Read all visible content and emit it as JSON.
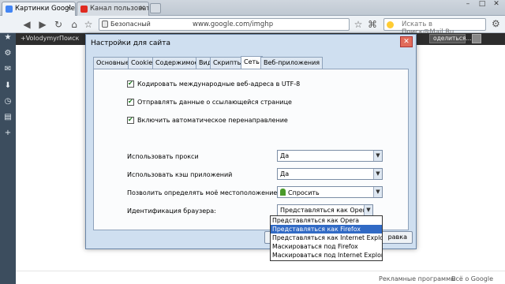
{
  "browser": {
    "tabs": [
      {
        "label": "Картинки Google",
        "active": true
      },
      {
        "label": "Канал пользовате...",
        "active": false
      }
    ],
    "address": {
      "security_label": "Безопасный",
      "url": "www.google.com/imghp"
    },
    "search": {
      "placeholder": "Искать в Поиск@Mail.Ru"
    }
  },
  "google_bar": {
    "user": "+Volodymyr",
    "search": "Поиск",
    "share": "оделиться..."
  },
  "footer": {
    "ads": "Рекламные программы",
    "about": "Всё о Google"
  },
  "dialog": {
    "title": "Настройки для сайта",
    "close_label": "✕",
    "tabs": [
      "Основные",
      "Cookies",
      "Содержимое",
      "Вид",
      "Скрипты",
      "Сеть",
      "Веб-приложения"
    ],
    "selected_tab": "Сеть",
    "checkboxes": [
      {
        "label": "Кодировать международные веб-адреса в UTF-8",
        "checked": true
      },
      {
        "label": "Отправлять данные о ссылающейся странице",
        "checked": true
      },
      {
        "label": "Включить автоматическое перенаправление",
        "checked": true
      }
    ],
    "settings": [
      {
        "label": "Использовать прокси",
        "value": "Да"
      },
      {
        "label": "Использовать кэш приложений",
        "value": "Да"
      },
      {
        "label": "Позволить определять моё местоположение",
        "value": "Спросить"
      },
      {
        "label": "Идентификация браузера:",
        "value": "Представляться как Opera"
      }
    ],
    "help_button": "равка"
  },
  "browser_id_dropdown": {
    "options": [
      "Представляться как Opera",
      "Представляться как Firefox",
      "Представляться как Internet Explorer",
      "Маскироваться под Firefox",
      "Маскироваться под Internet Explorer"
    ],
    "highlighted_index": 1
  },
  "colors": {
    "sidebar": "#3c4d5e",
    "dialog_bg": "#cfdff0",
    "highlight": "#316ac5"
  }
}
